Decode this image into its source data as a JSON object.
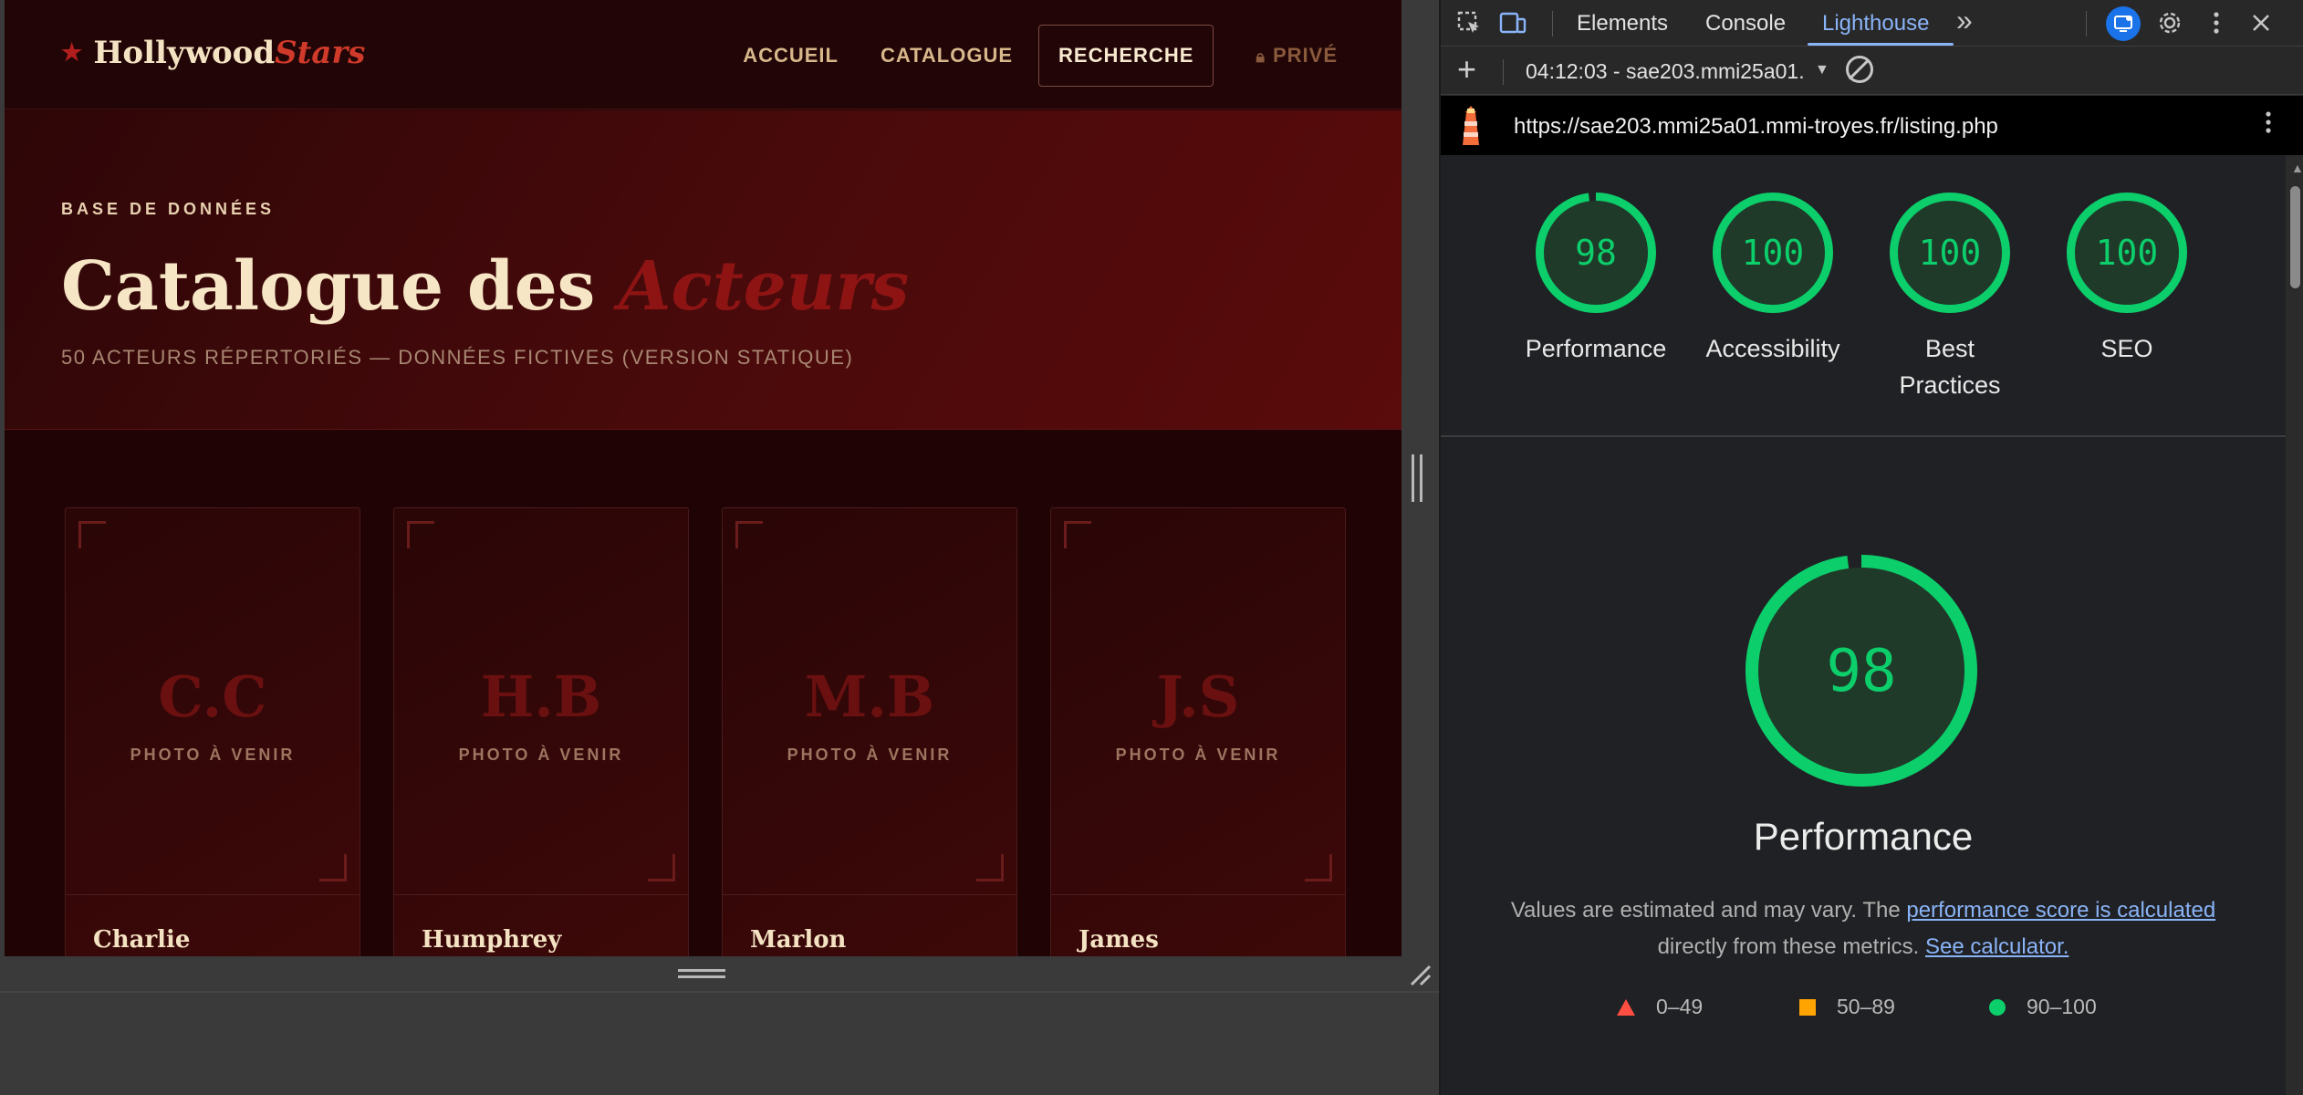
{
  "site": {
    "logo": {
      "star": "★",
      "main": "Hollywood",
      "accent": "Stars"
    },
    "nav": [
      {
        "label": "ACCUEIL"
      },
      {
        "label": "CATALOGUE"
      },
      {
        "label": "RECHERCHE"
      },
      {
        "label": "PRIVÉ",
        "icon": "lock-icon"
      }
    ],
    "hero": {
      "kicker": "BASE DE DONNÉES",
      "title_main": "Catalogue des",
      "title_accent": "Acteurs",
      "subtitle": "50 ACTEURS RÉPERTORIÉS — DONNÉES FICTIVES (VERSION STATIQUE)"
    },
    "cards": [
      {
        "initials": "C.C",
        "placeholder": "PHOTO À VENIR",
        "name": "Charlie"
      },
      {
        "initials": "H.B",
        "placeholder": "PHOTO À VENIR",
        "name": "Humphrey"
      },
      {
        "initials": "M.B",
        "placeholder": "PHOTO À VENIR",
        "name": "Marlon"
      },
      {
        "initials": "J.S",
        "placeholder": "PHOTO À VENIR",
        "name": "James"
      }
    ]
  },
  "devtools": {
    "tabs": [
      {
        "label": "Elements"
      },
      {
        "label": "Console"
      },
      {
        "label": "Lighthouse",
        "active": true
      }
    ],
    "more_tabs": "»",
    "toolbar": {
      "add": "+",
      "report": "04:12:03 - sae203.mmi25a01."
    },
    "url": "https://sae203.mmi25a01.mmi-troyes.fr/listing.php",
    "scores": [
      {
        "label": "Performance",
        "value": 98
      },
      {
        "label": "Accessibility",
        "value": 100
      },
      {
        "label": "Best Practices",
        "value": 100
      },
      {
        "label": "SEO",
        "value": 100
      }
    ],
    "performance": {
      "title": "Performance",
      "score": 98,
      "desc_before": "Values are estimated and may vary. The ",
      "desc_link1": "performance score is calculated",
      "desc_middle": " directly from these metrics.",
      "desc_link2": "See calculator."
    },
    "legend": [
      {
        "range": "0–49",
        "shape": "triangle",
        "color": "#ff4e42"
      },
      {
        "range": "50–89",
        "shape": "square",
        "color": "#ffa400"
      },
      {
        "range": "90–100",
        "shape": "circle",
        "color": "#0cce6b"
      }
    ],
    "colors": {
      "pass": "#0cce6b",
      "gauge_fill": "#1f3a29",
      "link": "#8ab4f8"
    }
  }
}
